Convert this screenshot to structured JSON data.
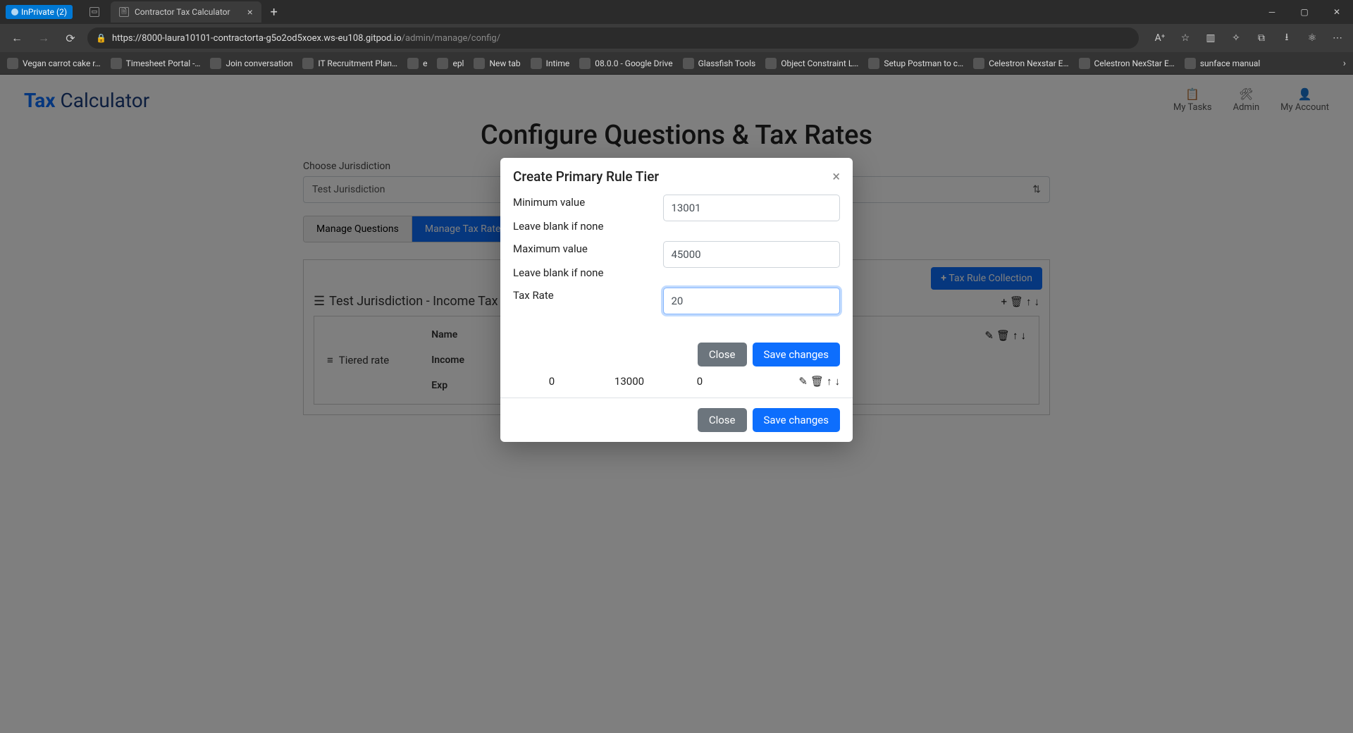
{
  "browser": {
    "inprivate_label": "InPrivate (2)",
    "tab_title": "Contractor Tax Calculator",
    "url_host": "https://8000-laura10101-contractorta-g5o2od5xoex.ws-eu108.gitpod.io",
    "url_path": "/admin/manage/config/",
    "bookmarks": [
      "Vegan carrot cake r…",
      "Timesheet Portal -…",
      "Join conversation",
      "IT Recruitment Plan…",
      "e",
      "epl",
      "New tab",
      "Intime",
      "08.0.0 - Google Drive",
      "Glassfish Tools",
      "Object Constraint L…",
      "Setup Postman to c…",
      "Celestron Nexstar E…",
      "Celestron NexStar E…",
      "sunface manual"
    ]
  },
  "app": {
    "brand_tax": "Tax",
    "brand_calc": "Calculator",
    "header_actions": {
      "tasks": "My Tasks",
      "admin": "Admin",
      "account": "My Account"
    },
    "page_title": "Configure Questions & Tax Rates",
    "jurisdiction_label": "Choose Jurisdiction",
    "jurisdiction_value": "Test Jurisdiction",
    "tabs": {
      "questions": "Manage Questions",
      "rates": "Manage Tax Rates"
    },
    "tax_rule_btn": "Tax Rule Collection",
    "collection_title": "Test Jurisdiction - Income Tax",
    "tiered_rate": "Tiered rate",
    "meta_name": "Name",
    "meta_income": "Income",
    "meta_exp": "Exp"
  },
  "modal": {
    "title": "Create Primary Rule Tier",
    "min_label": "Minimum value",
    "min_hint": "Leave blank if none",
    "min_value": "13001",
    "max_label": "Maximum value",
    "max_hint": "Leave blank if none",
    "max_value": "45000",
    "rate_label": "Tax Rate",
    "rate_value": "20",
    "close_btn": "Close",
    "save_btn": "Save changes",
    "tier_row": {
      "c1": "0",
      "c2": "13000",
      "c3": "0"
    }
  }
}
